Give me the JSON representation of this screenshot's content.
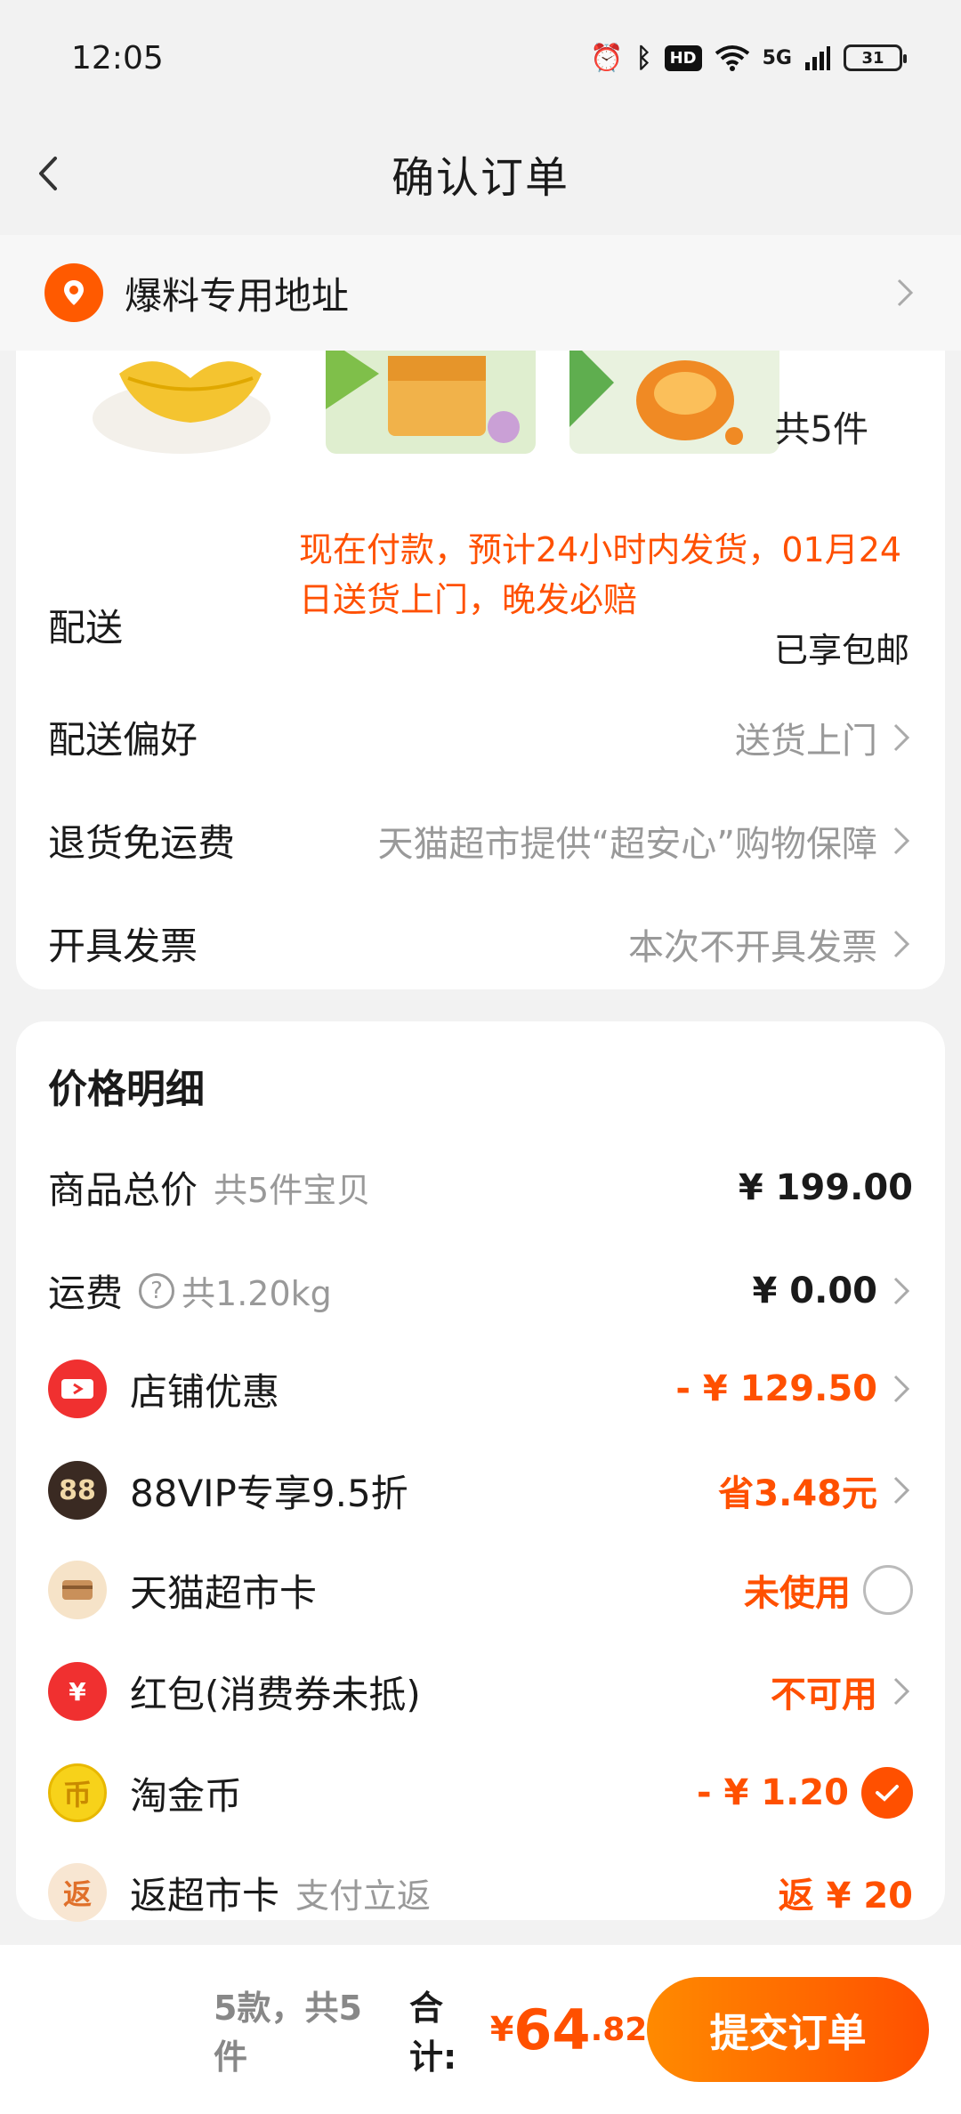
{
  "status": {
    "time": "12:05",
    "hd": "HD",
    "network": "5G",
    "battery": "31"
  },
  "nav": {
    "title": "确认订单"
  },
  "address": {
    "label": "爆料专用地址"
  },
  "items": {
    "qty": "共5件"
  },
  "delivery": {
    "label": "配送",
    "note": "现在付款，预计24小时内发货，01月24日送货上门，晚发必赔",
    "free_shipping": "已享包邮"
  },
  "rows": [
    {
      "label": "配送偏好",
      "value": "送货上门"
    },
    {
      "label": "退货免运费",
      "value": "天猫超市提供“超安心”购物保障"
    },
    {
      "label": "开具发票",
      "value": "本次不开具发票"
    }
  ],
  "price": {
    "title": "价格明细",
    "goods_total": {
      "label": "商品总价",
      "sub": "共5件宝贝",
      "value": "¥ 199.00"
    },
    "shipping": {
      "label": "运费",
      "sub": "共1.20kg",
      "value": "¥ 0.00"
    },
    "store_discount": {
      "label": "店铺优惠",
      "value": "- ¥ 129.50"
    },
    "vip": {
      "icon_text": "88",
      "label": "88VIP专享9.5折",
      "value": "省3.48元"
    },
    "market_card": {
      "label": "天猫超市卡",
      "value": "未使用"
    },
    "red_packet": {
      "icon_text": "¥",
      "label": "红包(消费券未抵)",
      "value": "不可用"
    },
    "coins": {
      "icon_text": "币",
      "label": "淘金币",
      "value": "- ¥ 1.20"
    },
    "cashback": {
      "icon_text": "返",
      "label": "返超市卡",
      "sub": "支付立返",
      "value": "返 ¥ 20"
    }
  },
  "footer": {
    "summary": "5款，共5件",
    "total_label": "合计:",
    "currency": "¥",
    "total_int": "64",
    "total_dec": ".82",
    "submit": "提交订单"
  },
  "colors": {
    "accent": "#ff5000",
    "accent_light": "#ff8a00",
    "background": "#f2f2f2"
  }
}
